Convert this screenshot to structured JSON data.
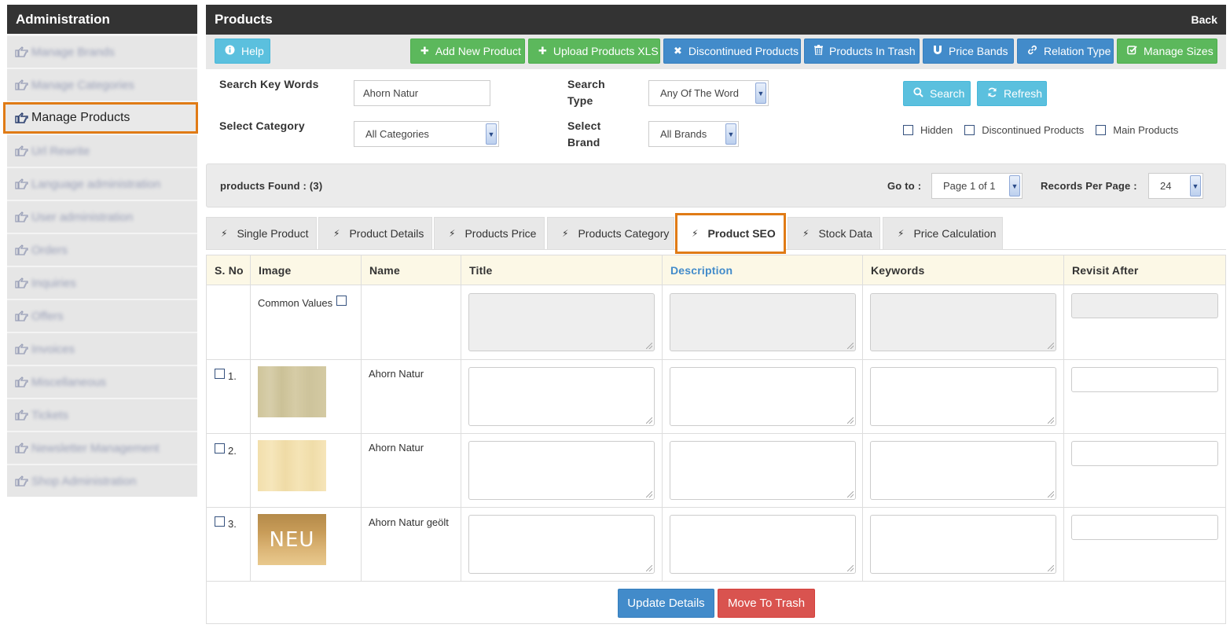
{
  "sidebar": {
    "title": "Administration",
    "items": [
      {
        "label": "Manage Brands",
        "active": false
      },
      {
        "label": "Manage Categories",
        "active": false
      },
      {
        "label": "Manage Products",
        "active": true
      },
      {
        "label": "Url Rewrite",
        "active": false
      },
      {
        "label": "Language administration",
        "active": false
      },
      {
        "label": "User administration",
        "active": false
      },
      {
        "label": "Orders",
        "active": false
      },
      {
        "label": "Inquiries",
        "active": false
      },
      {
        "label": "Offers",
        "active": false
      },
      {
        "label": "Invoices",
        "active": false
      },
      {
        "label": "Miscellaneous",
        "active": false
      },
      {
        "label": "Tickets",
        "active": false
      },
      {
        "label": "Newsletter Management",
        "active": false
      },
      {
        "label": "Shop Administration",
        "active": false
      }
    ]
  },
  "header": {
    "title": "Products",
    "back_label": "Back"
  },
  "toolbar": {
    "help": "Help",
    "add_new_product": "Add New Product",
    "upload_xls": "Upload Products XLS",
    "discontinued": "Discontinued Products",
    "trash": "Products In Trash",
    "price_bands": "Price Bands",
    "relation_type": "Relation Type",
    "manage_sizes": "Manage Sizes"
  },
  "search": {
    "keywords_label": "Search Key Words",
    "keywords_value": "Ahorn Natur",
    "type_label_1": "Search",
    "type_label_2": "Type",
    "type_value": "Any Of The Word",
    "category_label": "Select Category",
    "category_value": "All Categories",
    "brand_label_1": "Select",
    "brand_label_2": "Brand",
    "brand_value": "All Brands",
    "search_button": "Search",
    "refresh_button": "Refresh",
    "filters": {
      "hidden": "Hidden",
      "discontinued": "Discontinued Products",
      "main": "Main Products"
    }
  },
  "results": {
    "found_label": "products Found : (3)",
    "goto_label": "Go to :",
    "page_value": "Page 1 of 1",
    "per_page_label": "Records Per Page :",
    "per_page_value": "24"
  },
  "tabs": [
    {
      "label": "Single Product"
    },
    {
      "label": "Product Details"
    },
    {
      "label": "Products Price"
    },
    {
      "label": "Products Category"
    },
    {
      "label": "Product SEO",
      "active": true
    },
    {
      "label": "Stock Data"
    },
    {
      "label": "Price Calculation"
    }
  ],
  "table": {
    "columns": [
      "S. No",
      "Image",
      "Name",
      "Title",
      "Description",
      "Keywords",
      "Revisit After"
    ],
    "common_values_label": "Common Values",
    "rows": [
      {
        "sno": "1.",
        "name": "Ahorn Natur"
      },
      {
        "sno": "2.",
        "name": "Ahorn Natur"
      },
      {
        "sno": "3.",
        "name": "Ahorn Natur geölt",
        "badge": "NEU"
      }
    ]
  },
  "footer": {
    "update": "Update Details",
    "trash": "Move To Trash"
  },
  "colors": {
    "accent": "#e07b16",
    "header_bg": "#333333",
    "success": "#5cb85c",
    "primary": "#428bca",
    "info": "#5bc0de",
    "danger": "#d9534f"
  }
}
